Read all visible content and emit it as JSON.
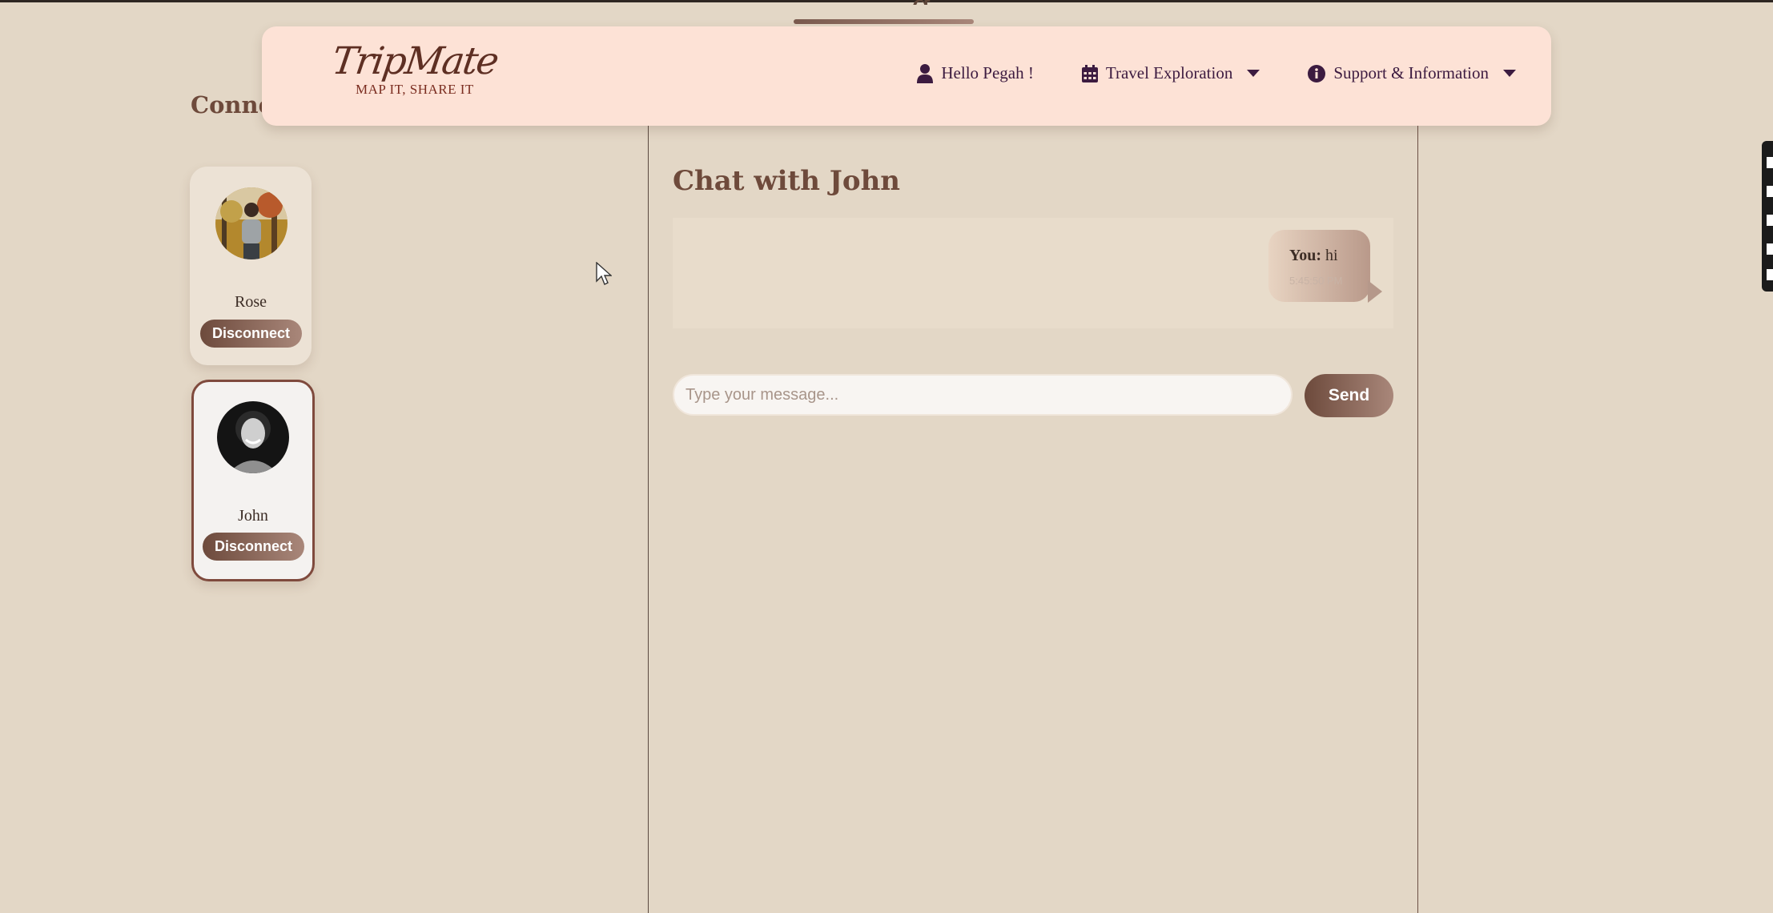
{
  "navbar": {
    "logo": {
      "name": "TripMate",
      "tagline": "MAP IT, SHARE IT"
    },
    "items": [
      {
        "label": "Hello Pegah !",
        "icon": "user-icon"
      },
      {
        "label": "Travel Exploration",
        "icon": "calendar-icon",
        "dropdown": true
      },
      {
        "label": "Support & Information",
        "icon": "info-circle-icon",
        "dropdown": true
      }
    ]
  },
  "sidebar": {
    "title": "Connec",
    "connections": [
      {
        "name": "Rose",
        "action": "Disconnect",
        "selected": false
      },
      {
        "name": "John",
        "action": "Disconnect",
        "selected": true
      }
    ]
  },
  "chat": {
    "title": "Chat with John",
    "messages": [
      {
        "sender": "You:",
        "text": "hi",
        "time": "5:45:50 PM"
      }
    ],
    "input": {
      "placeholder": "Type your message...",
      "value": ""
    },
    "send_label": "Send"
  },
  "colors": {
    "page_background": "#e3d7c6",
    "navbar_background": "#fde2d6",
    "accent_brown": "#6e4a3b",
    "nav_text": "#3c1b40"
  }
}
